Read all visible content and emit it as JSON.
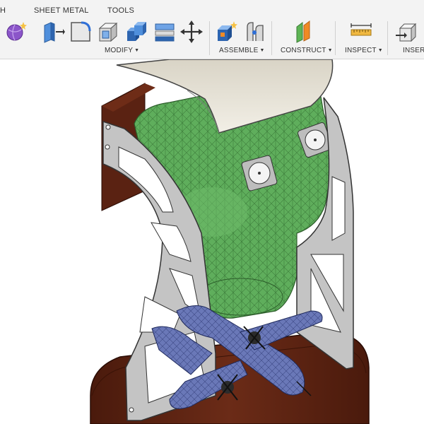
{
  "toolbar": {
    "tabs": [
      "H",
      "SHEET METAL",
      "TOOLS"
    ],
    "groups": [
      "MODIFY",
      "ASSEMBLE",
      "CONSTRUCT",
      "INSPECT",
      "INSERT"
    ],
    "tools": {
      "create_form": "create-form-icon",
      "press_pull": "press-pull-icon",
      "fillet": "fillet-icon",
      "shell": "shell-icon",
      "combine": "combine-icon",
      "replace_face": "replace-face-icon",
      "move": "move-icon",
      "new_component": "new-component-icon",
      "joint": "joint-icon",
      "offset_plane": "offset-plane-icon",
      "measure": "measure-icon",
      "insert": "insert-icon"
    },
    "accent": "#2f6fd6"
  },
  "viewport": {
    "model_colors": {
      "mesh": "#5fae5c",
      "frame": "#c4c4c4",
      "wood": "#5b2414",
      "cover": "#e6e2d6",
      "airplane": "#6a78b8"
    }
  }
}
